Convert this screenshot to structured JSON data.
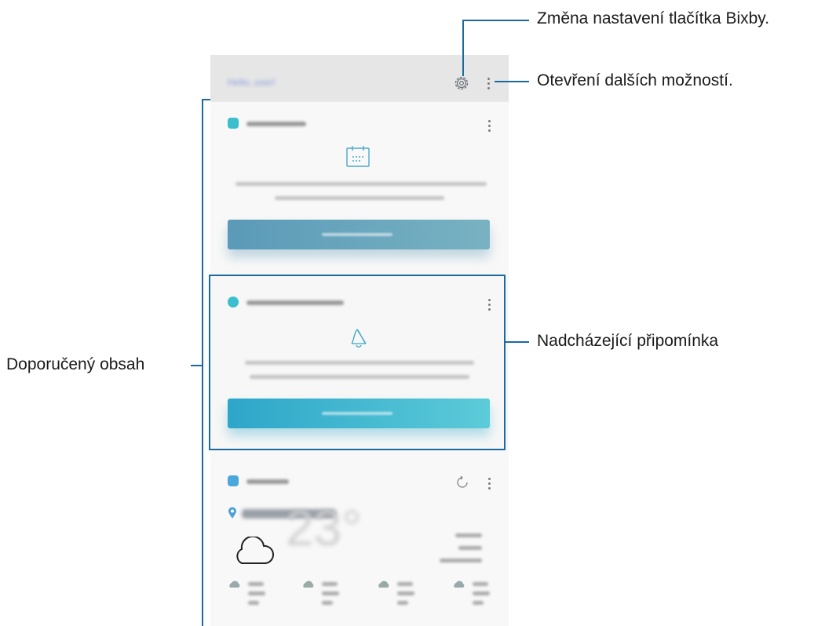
{
  "callouts": {
    "bixby_settings": "Změna nastavení tlačítka Bixby.",
    "more_options": "Otevření dalších možností.",
    "recommended_content": "Doporučený obsah",
    "upcoming_reminder": "Nadcházející připomínka"
  },
  "screen": {
    "greeting": "Hello, user!",
    "weather_temp": "23°"
  },
  "icons": {
    "settings": "gear-icon",
    "more": "more-options-icon",
    "calendar": "calendar-icon",
    "reminder": "bell-icon",
    "weather": "cloud-icon",
    "refresh": "refresh-icon",
    "location": "location-pin-icon"
  },
  "colors": {
    "callout_line": "#1a6aa0",
    "button1": "#5b9ab8",
    "button2": "#2ea6c9",
    "chip_teal": "#3bbfcf"
  }
}
